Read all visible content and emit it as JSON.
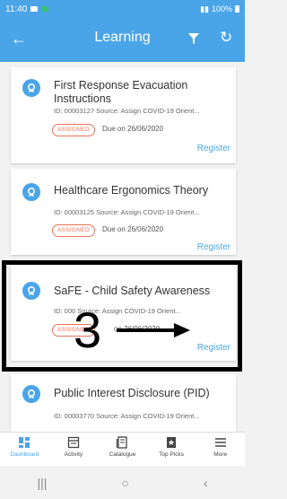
{
  "status_bar": {
    "time": "11:40",
    "battery": "100%"
  },
  "app_bar": {
    "title": "Learning",
    "back_glyph": "←",
    "refresh_glyph": "↻"
  },
  "cards": [
    {
      "title": "First Response Evacuation Instructions",
      "meta": "ID: 00003127  Source: Assign COVID-19 Orient...",
      "badge": "ASSIGNED",
      "due": "Due on 26/06/2020",
      "action": "Register"
    },
    {
      "title": "Healthcare Ergonomics Theory",
      "meta": "ID: 00003125  Source: Assign COVID-19 Orient...",
      "badge": "ASSIGNED",
      "due": "Due on 26/06/2020",
      "action": "Register"
    },
    {
      "title": "SaFE - Child Safety Awareness",
      "meta": "ID: 000  Source: Assign COVID-19 Orient...",
      "badge": "ASSIGNED",
      "due": "on 26/06/2020",
      "action": "Register"
    },
    {
      "title": "Public Interest Disclosure (PID)",
      "meta": "ID: 00003770  Source: Assign COVID-19 Orient..."
    }
  ],
  "annotation": {
    "step": "3"
  },
  "bottom_nav": [
    {
      "label": "Dashboard",
      "icon": "dashboard-icon"
    },
    {
      "label": "Activity",
      "icon": "activity-icon"
    },
    {
      "label": "Catalogue",
      "icon": "catalogue-icon"
    },
    {
      "label": "Top Picks",
      "icon": "top-picks-icon"
    },
    {
      "label": "More",
      "icon": "menu-icon"
    }
  ],
  "system_nav": {
    "recents_glyph": "|||",
    "home_glyph": "○",
    "back_glyph": "‹"
  },
  "colors": {
    "primary": "#4aa5e8",
    "badge": "#e8735a",
    "active_nav": "#4aa5e8"
  }
}
